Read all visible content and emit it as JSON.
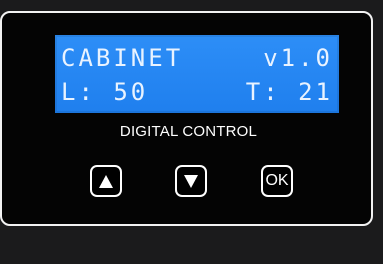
{
  "display": {
    "row1_left": "CABINET",
    "row1_right": "v1.0",
    "row2_left": "L: 50",
    "row2_right": "T: 21"
  },
  "panel_label": "DIGITAL CONTROL",
  "buttons": {
    "up_icon": "up-triangle",
    "down_icon": "down-triangle",
    "ok_label": "OK"
  },
  "colors": {
    "lcd_background": "#1f7fee",
    "lcd_text": "#e9f3ff",
    "panel": "#040404",
    "border": "#f2f2f2"
  }
}
